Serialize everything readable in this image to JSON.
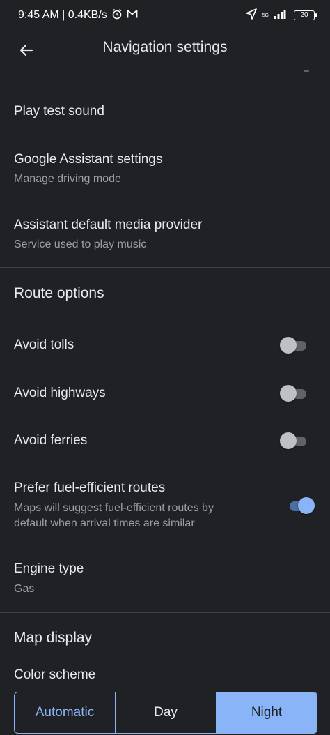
{
  "status_bar": {
    "time_speed": "9:45 AM | 0.4KB/s",
    "alarm_icon": "alarm-clock-icon",
    "mail_icon": "gmail-icon",
    "location_icon": "location-arrow-icon",
    "network_label": "5G",
    "signal_icon": "signal-bars-icon",
    "battery_level": "20"
  },
  "app_bar": {
    "title": "Navigation settings",
    "back_icon": "arrow-back-icon"
  },
  "rows": {
    "play_test_sound": {
      "title": "Play test sound"
    },
    "google_assistant": {
      "title": "Google Assistant settings",
      "subtitle": "Manage driving mode"
    },
    "assistant_media": {
      "title": "Assistant default media provider",
      "subtitle": "Service used to play music"
    }
  },
  "route_options": {
    "header": "Route options",
    "avoid_tolls": {
      "title": "Avoid tolls",
      "enabled": false
    },
    "avoid_highways": {
      "title": "Avoid highways",
      "enabled": false
    },
    "avoid_ferries": {
      "title": "Avoid ferries",
      "enabled": false
    },
    "fuel_efficient": {
      "title": "Prefer fuel-efficient routes",
      "subtitle_line1": "Maps will suggest fuel-efficient routes by",
      "subtitle_line2": "default when arrival times are similar",
      "enabled": true
    },
    "engine_type": {
      "title": "Engine type",
      "value": "Gas"
    }
  },
  "map_display": {
    "header": "Map display",
    "color_scheme_label": "Color scheme",
    "options": [
      "Automatic",
      "Day",
      "Night"
    ],
    "selected": "Night"
  },
  "colors": {
    "background": "#202124",
    "accent": "#8ab4f8",
    "text_primary": "#e8eaed",
    "text_secondary": "#9aa0a6",
    "divider": "#3c4043"
  }
}
